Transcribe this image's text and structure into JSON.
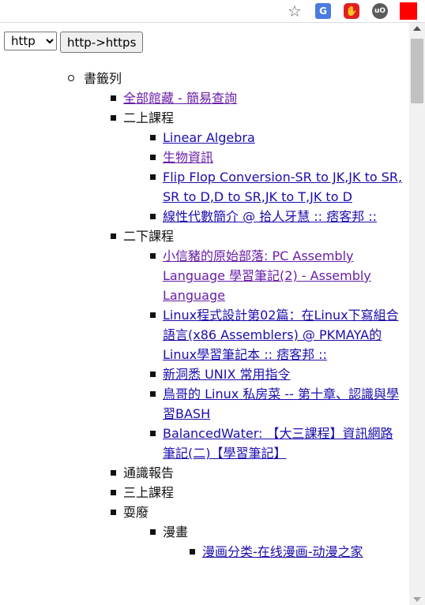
{
  "toolbar": {
    "icons": [
      "star-icon",
      "google-translate-icon",
      "adblock-icon",
      "ublock-icon",
      "red-extension-icon"
    ],
    "translate_glyph": "G",
    "ublock_glyph": "uO"
  },
  "controls": {
    "protocol_select_value": "http",
    "protocol_options": [
      "http"
    ],
    "convert_button_label": "http->https"
  },
  "tree": {
    "root_label": "書籤列",
    "folders": [
      {
        "label": "全部館藏 - 簡易查詢",
        "is_link": true
      },
      {
        "label": "二上課程",
        "links": [
          "Linear Algebra",
          "生物資訊",
          "Flip Flop Conversion-SR to JK,JK to SR, SR to D,D to SR,JK to T,JK to D",
          "線性代數簡介 @ 拾人牙慧 :: 痞客邦 ::"
        ]
      },
      {
        "label": "二下課程",
        "links": [
          "小信豬的原始部落: PC Assembly Language 學習筆記(2) - Assembly Language",
          "Linux程式設計第02篇：在Linux下寫組合語言(x86 Assemblers) @ PKMAYA的Linux學習筆記本 :: 痞客邦 ::",
          "新洞悉 UNIX 常用指令",
          "鳥哥的 Linux 私房菜 -- 第十章、認識與學習BASH",
          "BalancedWater: 【大三課程】資訊網路筆記(二)【學習筆記】"
        ]
      },
      {
        "label": "通識報告"
      },
      {
        "label": "三上課程"
      },
      {
        "label": "耍廢",
        "subfolders": [
          {
            "label": "漫畫",
            "links": [
              "漫画分类-在线漫画-动漫之家"
            ]
          }
        ]
      }
    ]
  },
  "colors": {
    "link": "#1a0dab",
    "visited_link": "#681da8",
    "adblock": "#e02020",
    "translate": "#4a7be0",
    "red_extension": "#ff0000"
  }
}
